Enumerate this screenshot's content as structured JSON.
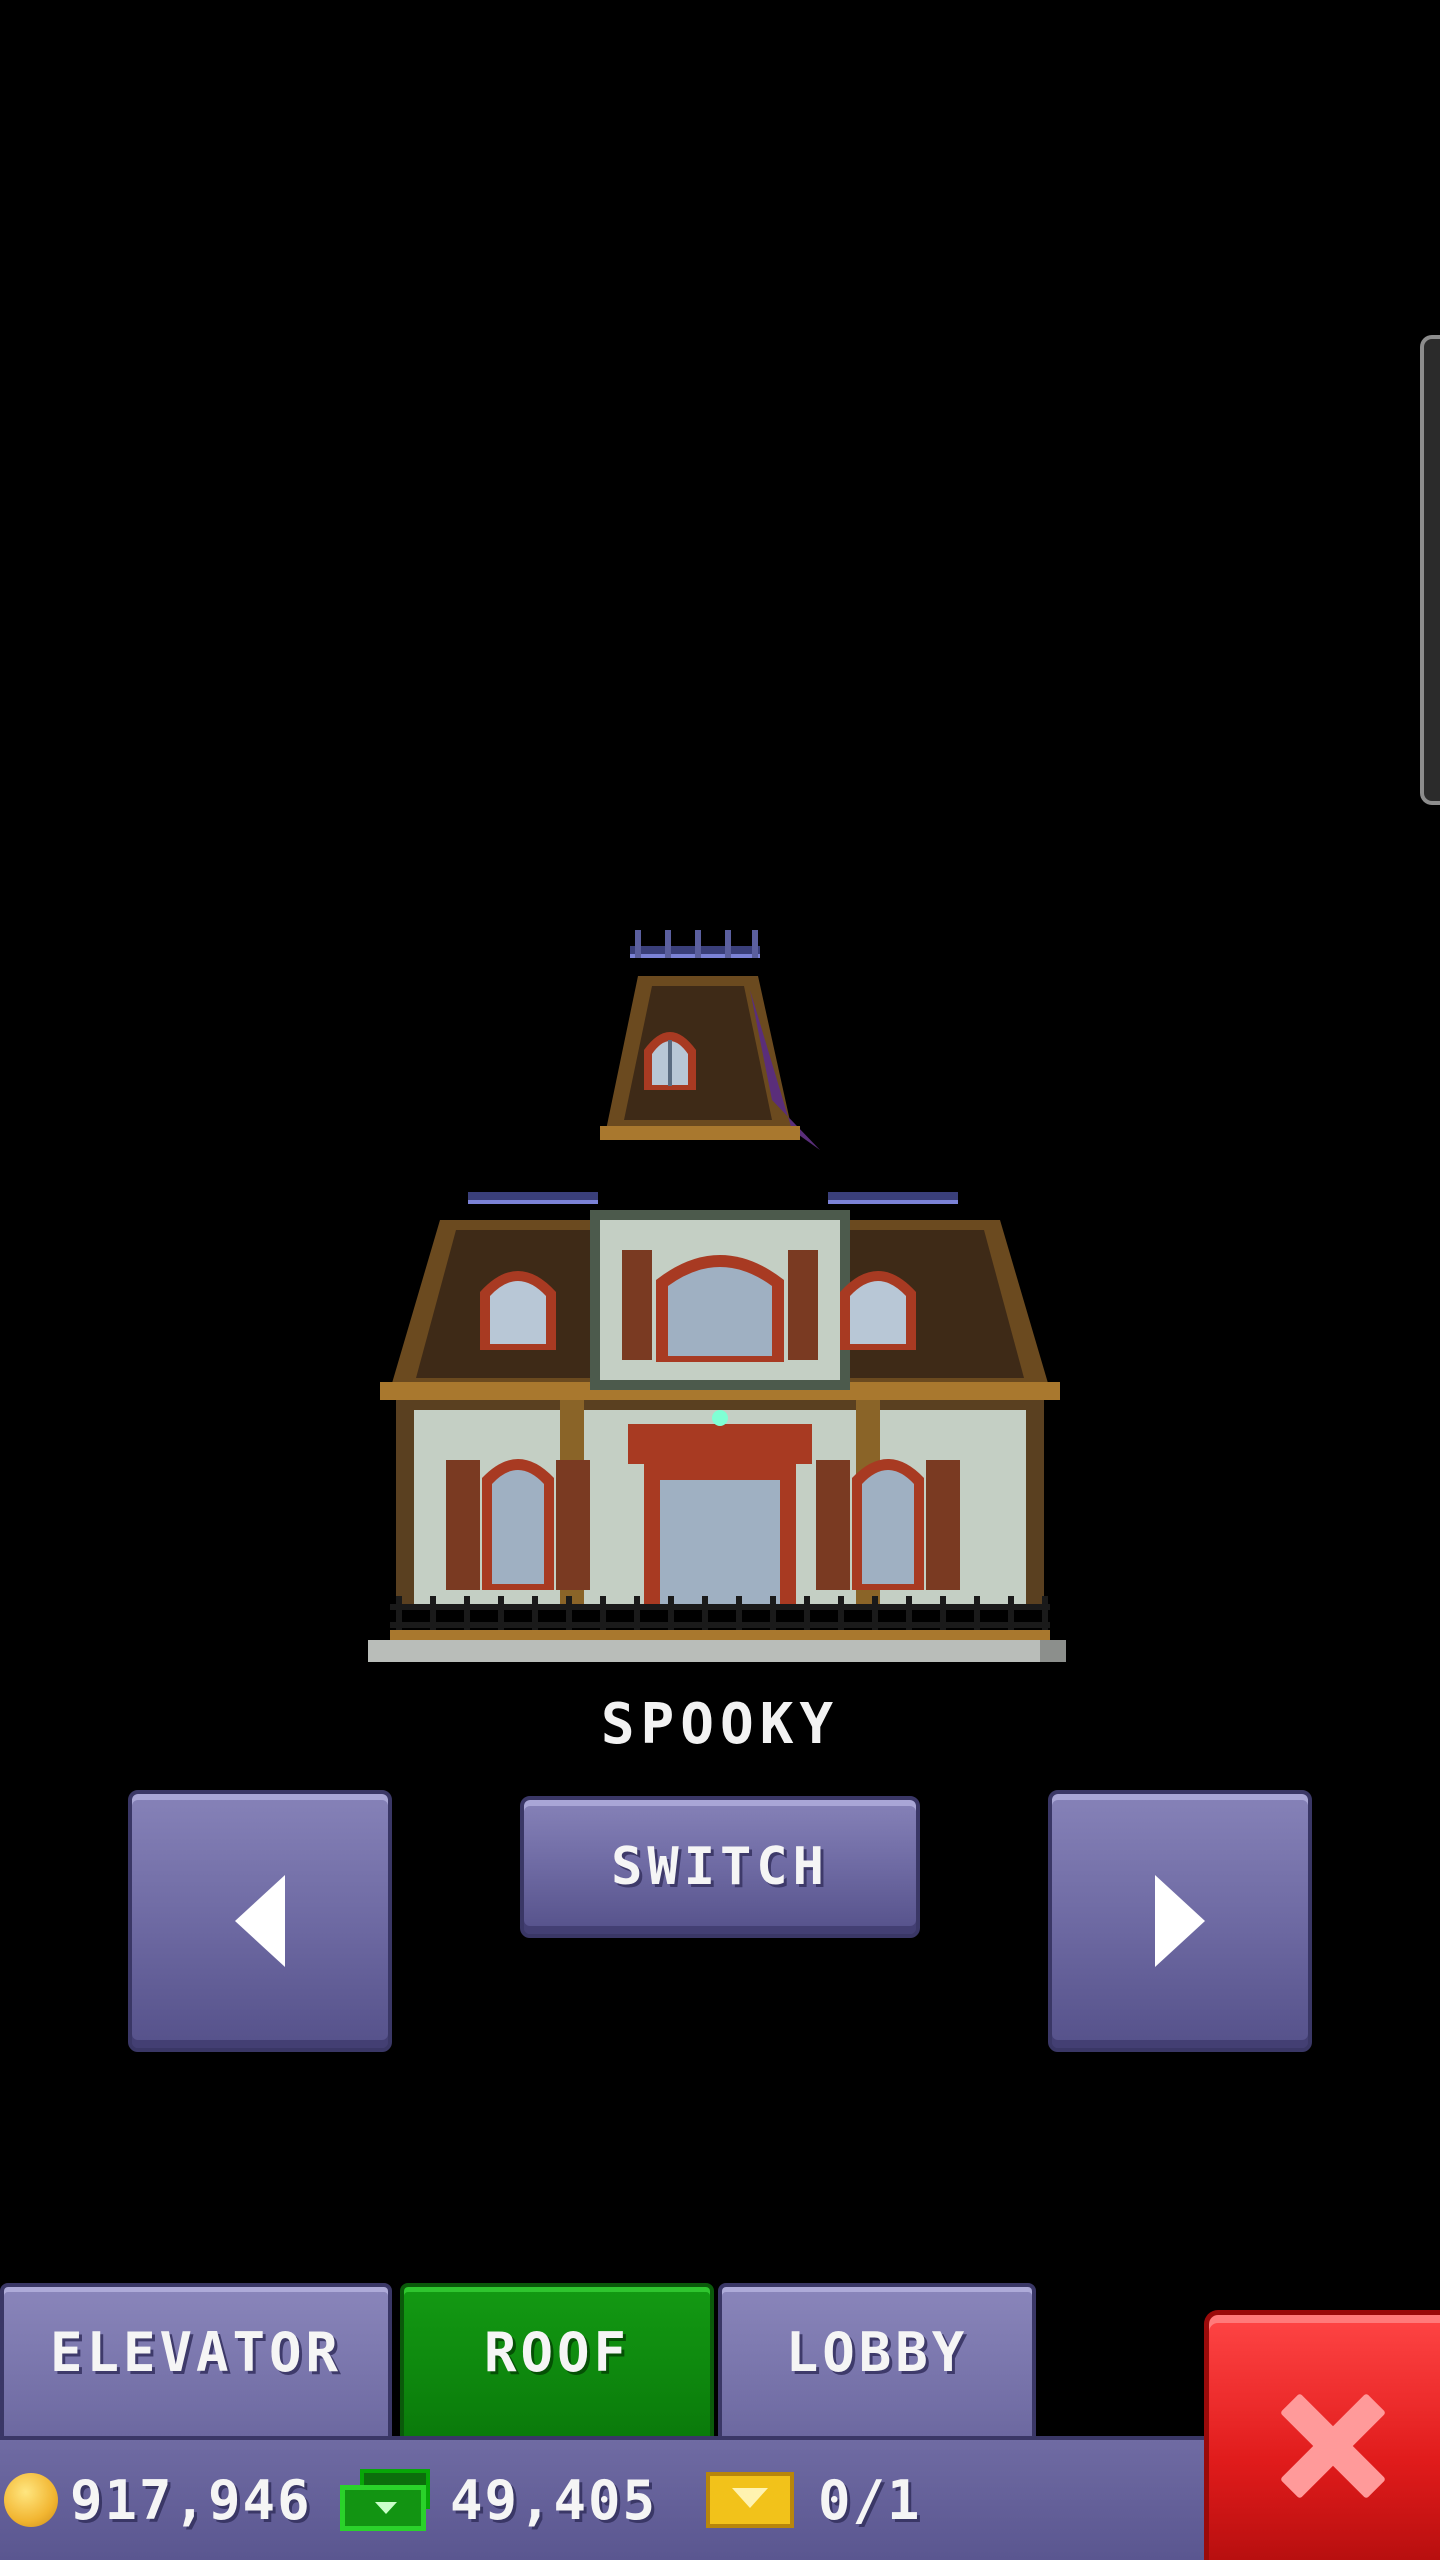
{
  "roof_preview": {
    "name": "SPOOKY"
  },
  "controls": {
    "prev_icon": "arrow-left-icon",
    "switch_label": "SWITCH",
    "next_icon": "arrow-right-icon"
  },
  "tabs": [
    {
      "label": "ELEVATOR",
      "active": false
    },
    {
      "label": "ROOF",
      "active": true
    },
    {
      "label": "LOBBY",
      "active": false
    }
  ],
  "status": {
    "coins": "917,946",
    "bux": "49,405",
    "tickets": "0/1"
  },
  "colors": {
    "accent_purple": "#6e6aa3",
    "active_tab_green": "#139a13",
    "close_red": "#e01b1b",
    "background": "#000000"
  }
}
